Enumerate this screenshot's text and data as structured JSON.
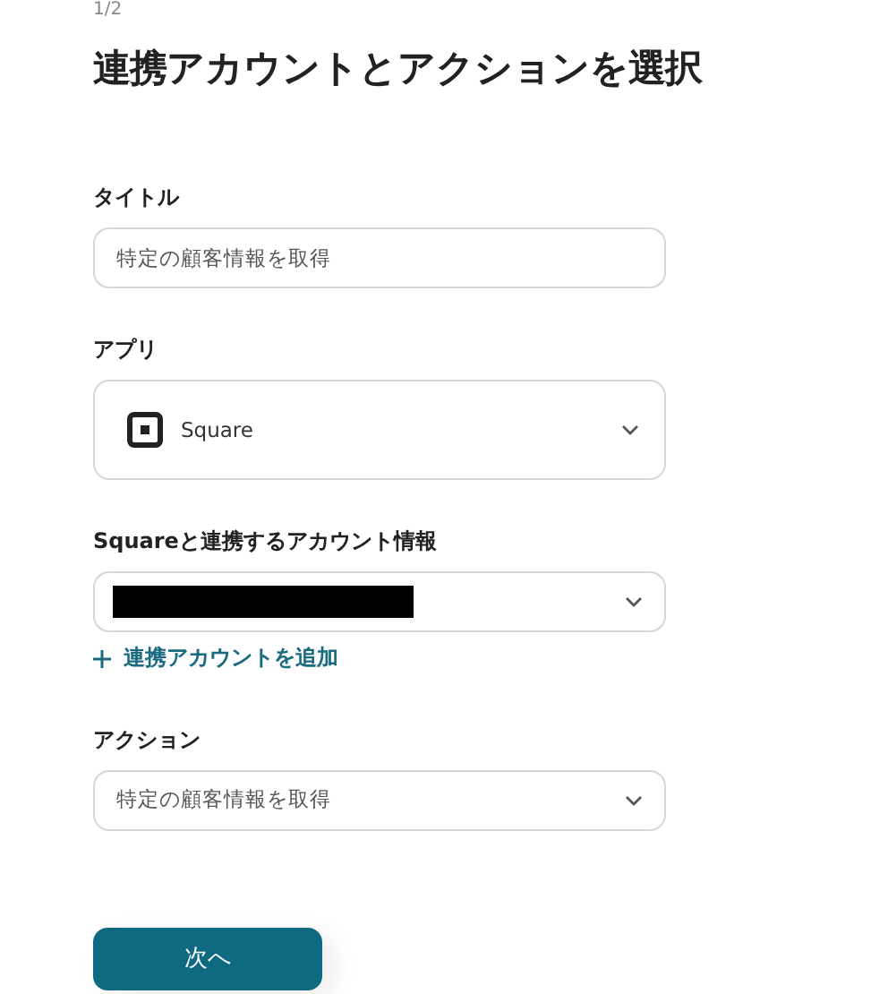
{
  "step": "1/2",
  "title": "連携アカウントとアクションを選択",
  "fields": [
    {
      "kind": "text",
      "label": "タイトル",
      "value": "特定の顧客情報を取得"
    },
    {
      "kind": "app-select",
      "label": "アプリ",
      "value": "Square"
    },
    {
      "kind": "redacted-select",
      "label": "Squareと連携するアカウント情報",
      "add_link": "連携アカウントを追加"
    },
    {
      "kind": "select",
      "label": "アクション",
      "value": "特定の顧客情報を取得"
    }
  ],
  "next_button": "次へ"
}
